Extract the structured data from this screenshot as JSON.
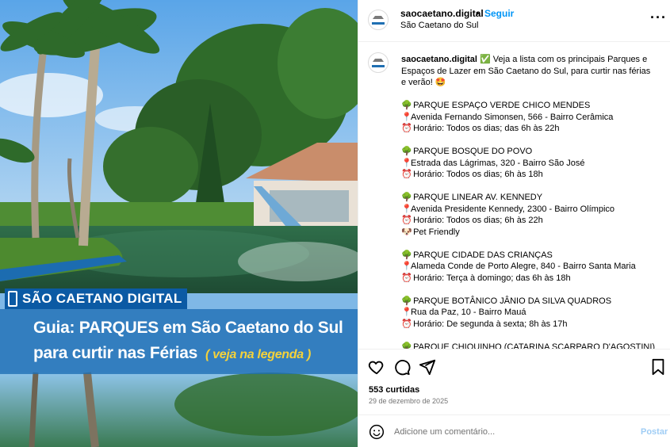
{
  "image": {
    "brand_label": "SÃO CAETANO DIGITAL",
    "headline_line1": "Guia: PARQUES em São Caetano do Sul",
    "headline_line2": "para curtir nas Férias",
    "headline_tag": "( veja na legenda )"
  },
  "header": {
    "username": "saocaetano.digital",
    "separator": "•",
    "follow_label": "Seguir",
    "location": "São Caetano do Sul",
    "more_label": "···"
  },
  "caption": {
    "username": "saocaetano.digital",
    "intro": "✅ Veja a lista com os principais Parques e Espaços de Lazer em São Caetano do Sul, para curtir nas férias e verão! 🤩",
    "parks": [
      {
        "icon": "🌳",
        "name": "PARQUE ESPAÇO VERDE CHICO MENDES",
        "address": "Avenida Fernando Simonsen, 566 - Bairro Cerâmica",
        "hours": "Horário: Todos os dias; das 6h às 22h"
      },
      {
        "icon": "🌳",
        "name": "PARQUE BOSQUE DO POVO",
        "address": "Estrada das Lágrimas, 320 - Bairro São José",
        "hours": "Horário: Todos os dias; 6h às 18h"
      },
      {
        "icon": "🌳",
        "name": "PARQUE LINEAR AV. KENNEDY",
        "address": "Avenida Presidente Kennedy, 2300 - Bairro Olímpico",
        "hours": "Horário: Todos os dias; 6h às 22h",
        "extra": "Pet Friendly"
      },
      {
        "icon": "🌳",
        "name": "PARQUE CIDADE DAS CRIANÇAS",
        "address": "Alameda Conde de Porto Alegre, 840 - Bairro Santa Maria",
        "hours": "Horário: Terça à domingo; das 6h às 18h"
      },
      {
        "icon": "🌳",
        "name": "PARQUE BOTÂNICO JÂNIO DA SILVA QUADROS",
        "address": "Rua da Paz, 10 - Bairro Mauá",
        "hours": "Horário: De segunda à sexta; 8h às 17h"
      },
      {
        "icon": "🌳",
        "name": "PARQUE CHIQUINHO (CATARINA SCARPARO D'AGOSTINI)"
      }
    ],
    "pin_icon": "📍",
    "clock_icon": "⏰",
    "pet_icon": "🐶"
  },
  "stats": {
    "likes": "553 curtidas",
    "date": "29 de dezembro de 2025"
  },
  "comment": {
    "placeholder": "Adicione um comentário...",
    "post_label": "Postar"
  },
  "colors": {
    "accent": "#0095f6",
    "brand_blue": "#0b5aa4",
    "tag_yellow": "#f5d23a"
  }
}
